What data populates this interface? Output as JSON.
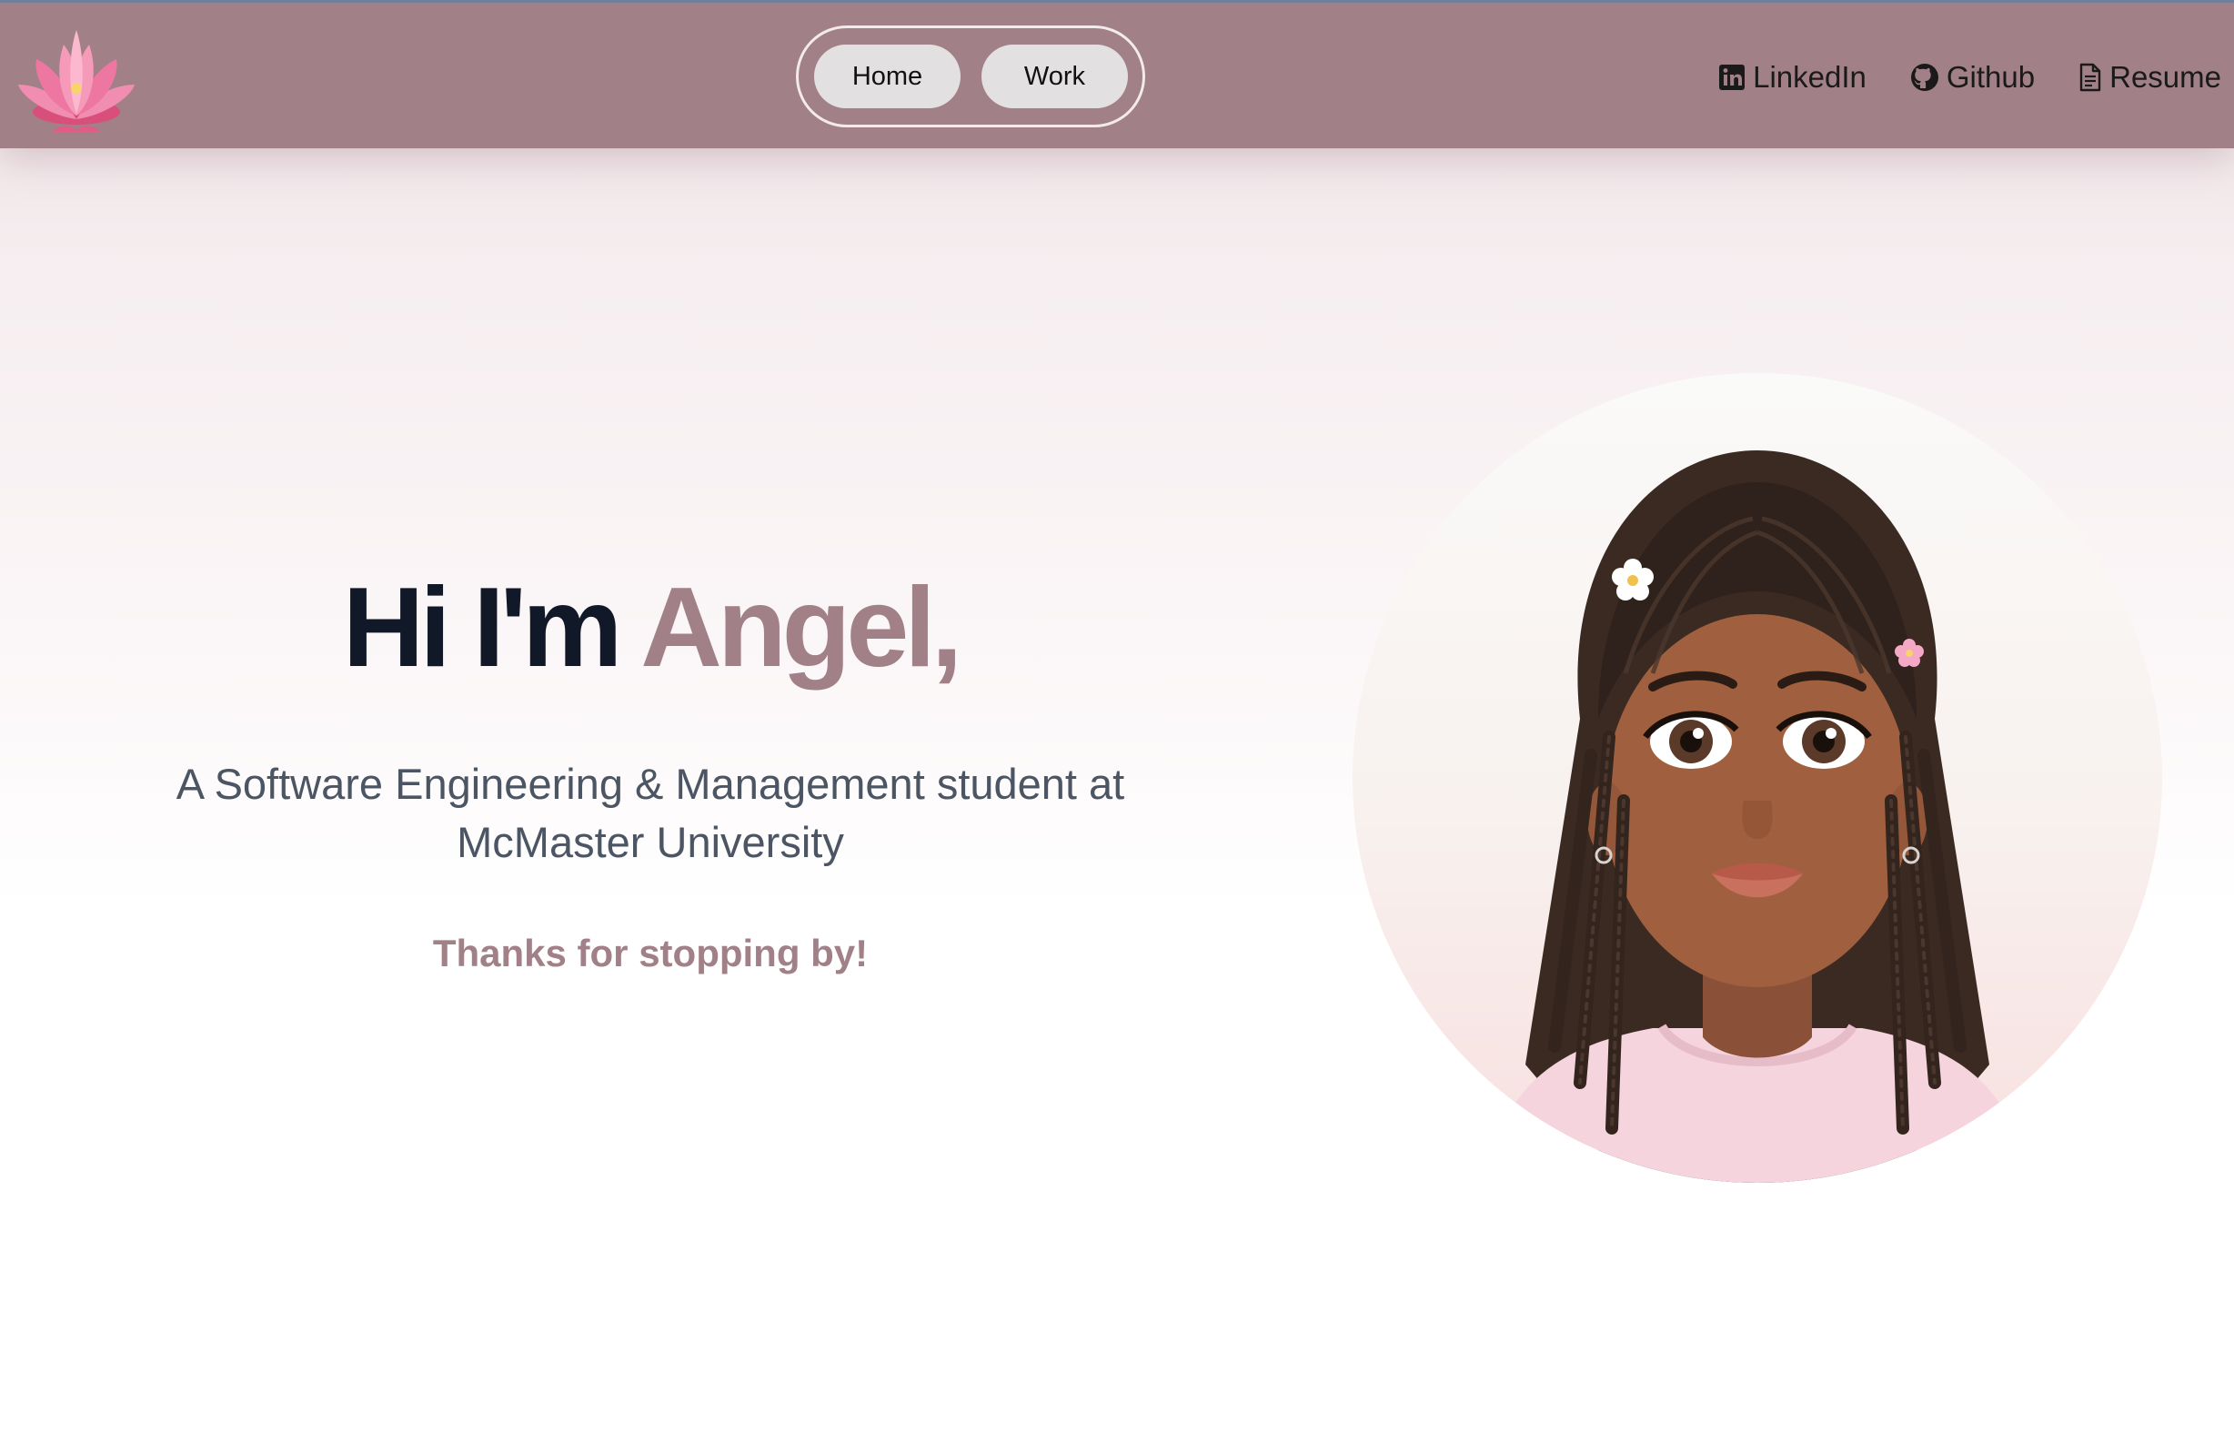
{
  "navbar": {
    "logo_icon": "lotus-flower-icon",
    "tabs": [
      {
        "label": "Home"
      },
      {
        "label": "Work"
      }
    ],
    "links": [
      {
        "label": "LinkedIn",
        "icon": "linkedin-icon"
      },
      {
        "label": "Github",
        "icon": "github-icon"
      },
      {
        "label": "Resume",
        "icon": "document-icon"
      }
    ]
  },
  "hero": {
    "greeting": "Hi I'm",
    "name": "Angel,",
    "subtitle": "A Software Engineering & Management student at McMaster University",
    "thanks": "Thanks for stopping by!",
    "avatar_icon": "cartoon-avatar-portrait"
  },
  "colors": {
    "navbar_bg": "#a18087",
    "accent": "#a18087",
    "heading": "#111827",
    "body_text": "#4b5563",
    "pill_bg": "#e3e0e1"
  }
}
